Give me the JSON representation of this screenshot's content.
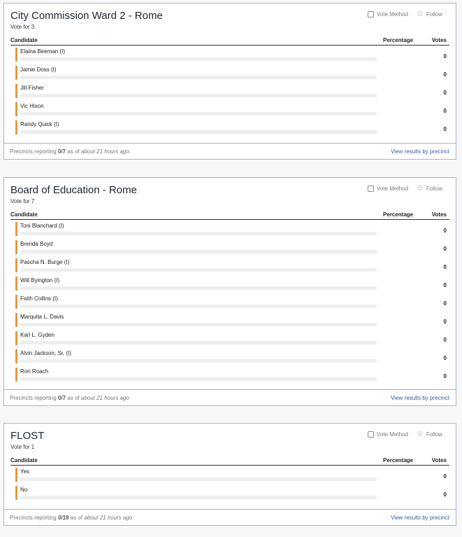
{
  "common": {
    "vote_method_label": "Vote Method",
    "follow_label": "Follow",
    "col_candidate": "Candidate",
    "col_percentage": "Percentage",
    "col_votes": "Votes",
    "precincts_prefix": "Precincts reporting",
    "as_of_text": "as of",
    "view_link": "View results by precinct",
    "accent_color": "#e39a3b"
  },
  "races": [
    {
      "title": "City Commission Ward 2 - Rome",
      "vote_for": "Vote for 3",
      "precincts": "0/7",
      "updated": "about 21 hours ago",
      "candidates": [
        {
          "name": "Elaina Beeman (I)",
          "percentage": "",
          "votes": "0",
          "share": 0
        },
        {
          "name": "Jamie Doss (I)",
          "percentage": "",
          "votes": "0",
          "share": 0
        },
        {
          "name": "Jill Fisher",
          "percentage": "",
          "votes": "0",
          "share": 0
        },
        {
          "name": "Vic Hixon",
          "percentage": "",
          "votes": "0",
          "share": 0
        },
        {
          "name": "Randy Quick (I)",
          "percentage": "",
          "votes": "0",
          "share": 0
        }
      ]
    },
    {
      "title": "Board of Education - Rome",
      "vote_for": "Vote for 7",
      "precincts": "0/7",
      "updated": "about 21 hours ago",
      "candidates": [
        {
          "name": "Toni Blanchard (I)",
          "percentage": "",
          "votes": "0",
          "share": 0
        },
        {
          "name": "Brenda Boyd",
          "percentage": "",
          "votes": "0",
          "share": 0
        },
        {
          "name": "Pascha N. Burge (I)",
          "percentage": "",
          "votes": "0",
          "share": 0
        },
        {
          "name": "Will Byington (I)",
          "percentage": "",
          "votes": "0",
          "share": 0
        },
        {
          "name": "Faith Collins (I)",
          "percentage": "",
          "votes": "0",
          "share": 0
        },
        {
          "name": "Marquita L. Davis",
          "percentage": "",
          "votes": "0",
          "share": 0
        },
        {
          "name": "Karl L. Gyden",
          "percentage": "",
          "votes": "0",
          "share": 0
        },
        {
          "name": "Alvin Jackson, Sr. (I)",
          "percentage": "",
          "votes": "0",
          "share": 0
        },
        {
          "name": "Ron Roach",
          "percentage": "",
          "votes": "0",
          "share": 0
        }
      ]
    },
    {
      "title": "FLOST",
      "vote_for": "Vote for 1",
      "precincts": "0/19",
      "updated": "about 21 hours ago",
      "candidates": [
        {
          "name": "Yes",
          "percentage": "",
          "votes": "0",
          "share": 0
        },
        {
          "name": "No",
          "percentage": "",
          "votes": "0",
          "share": 0
        }
      ]
    }
  ]
}
